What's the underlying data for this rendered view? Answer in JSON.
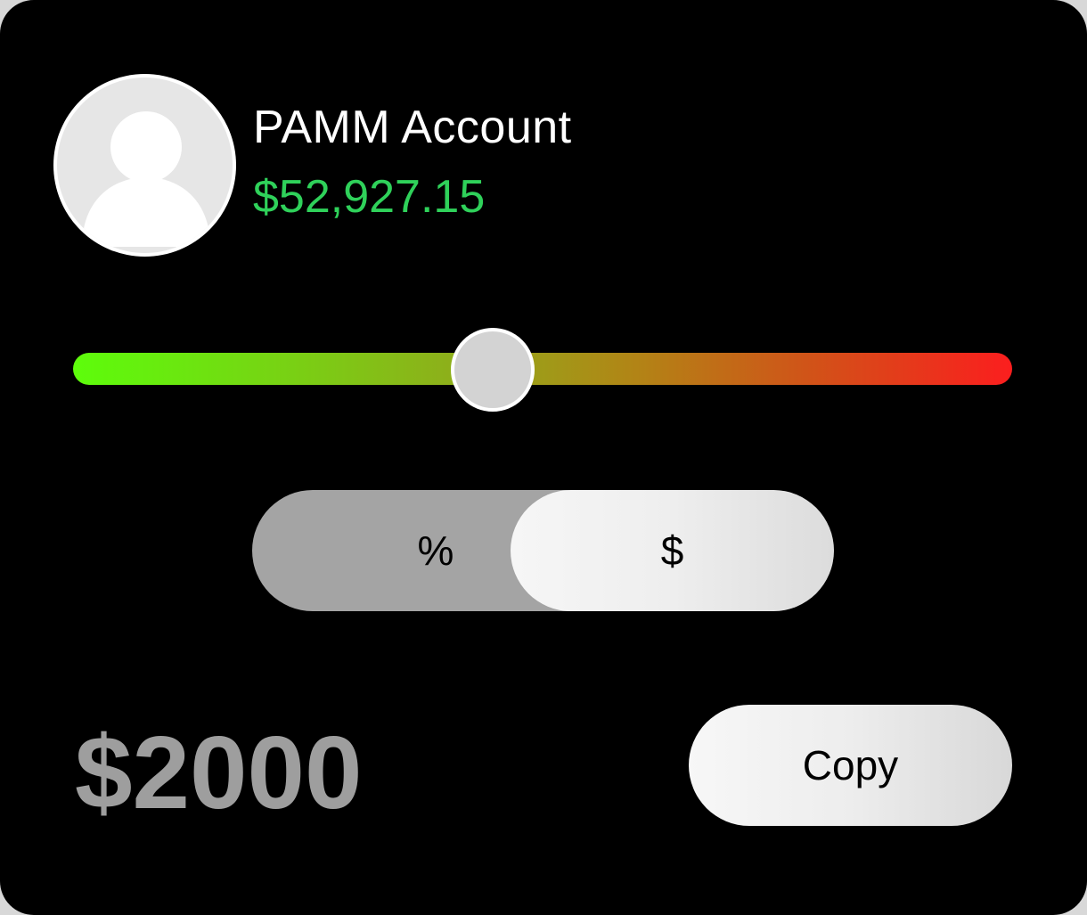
{
  "account": {
    "name": "PAMM Account",
    "balance": "$52,927.15",
    "avatar_icon": "user-placeholder-icon",
    "balance_color": "#2fd15a"
  },
  "slider": {
    "value_fraction": 0.445,
    "gradient_start": "#5dfd0b",
    "gradient_end": "#fb1e1e"
  },
  "mode_toggle": {
    "options": [
      "%",
      "$"
    ],
    "selected": "$"
  },
  "amount": {
    "value": "$2000"
  },
  "actions": {
    "copy_label": "Copy"
  }
}
